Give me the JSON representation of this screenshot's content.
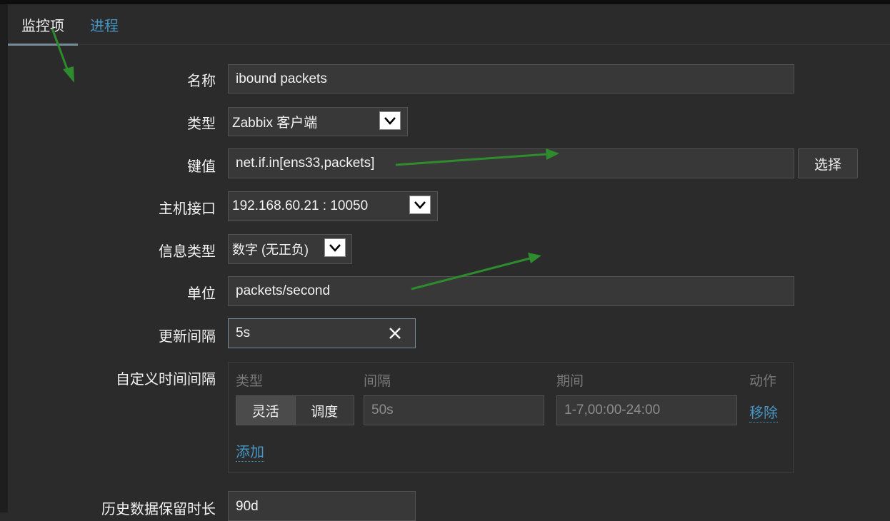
{
  "tabs": {
    "items": "监控项",
    "process": "进程"
  },
  "form": {
    "name": {
      "label": "名称",
      "value": "ibound packets"
    },
    "type": {
      "label": "类型",
      "value": "Zabbix 客户端"
    },
    "key": {
      "label": "键值",
      "value": "net.if.in[ens33,packets]",
      "select_button": "选择"
    },
    "host_interface": {
      "label": "主机接口",
      "value": "192.168.60.21 : 10050"
    },
    "info_type": {
      "label": "信息类型",
      "value": "数字 (无正负)"
    },
    "units": {
      "label": "单位",
      "value": "packets/second"
    },
    "update_interval": {
      "label": "更新间隔",
      "value": "5s"
    },
    "custom_intervals": {
      "label": "自定义时间间隔",
      "col_type": "类型",
      "col_interval": "间隔",
      "col_period": "期间",
      "col_action": "动作",
      "row": {
        "flexible": "灵活",
        "scheduling": "调度",
        "interval_placeholder": "50s",
        "period_placeholder": "1-7,00:00-24:00",
        "remove": "移除"
      },
      "add": "添加"
    },
    "history": {
      "label": "历史数据保留时长",
      "value": "90d"
    }
  },
  "colors": {
    "background": "#2b2b2b",
    "field": "#383838",
    "link": "#4796c4",
    "annotation_arrow": "#2e8b2e"
  }
}
